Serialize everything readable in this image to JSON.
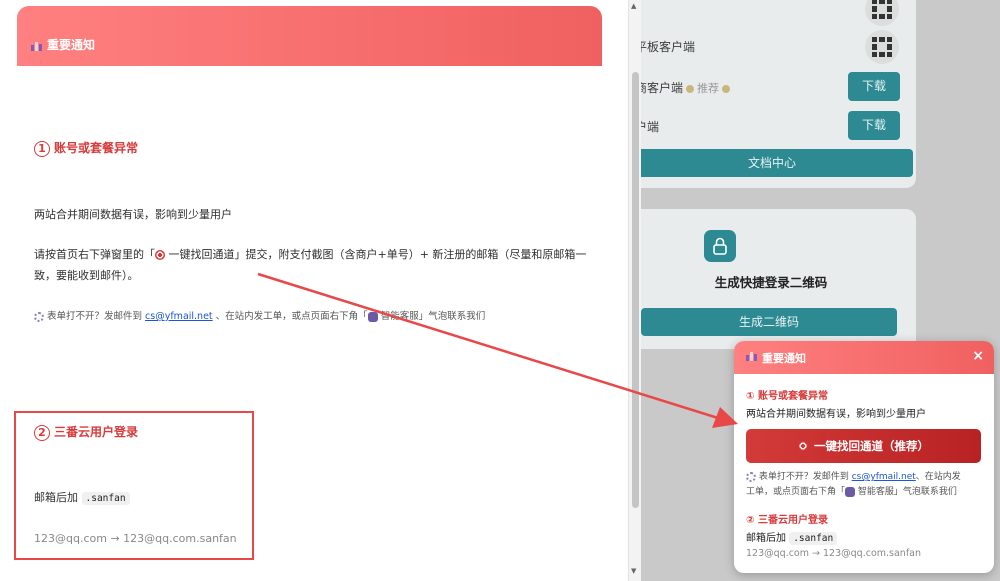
{
  "background_app": {
    "rows": [
      {
        "label": "平板客户端",
        "action": "qr"
      },
      {
        "label": "商客户端",
        "tag": "推荐",
        "action": "下载"
      },
      {
        "label": "户端",
        "action": "下载"
      }
    ],
    "doc_center_label": "文档中心",
    "quick_login": {
      "title": "生成快捷登录二维码",
      "button_label": "生成二维码"
    }
  },
  "notice": {
    "header_title": "重要通知",
    "section1": {
      "num": "1",
      "title": "账号或套餐异常",
      "line1": "两站合并期间数据有误，影响到少量用户",
      "para_a": "请按首页右下弹窗里的「",
      "para_b": " 一键找回通道」提交，附支付截图（含商户+单号）+ 新注册的邮箱（尽量和原邮箱一",
      "para_c": "致，要能收到邮件）。",
      "tip_a": " 表单打不开？发邮件到 ",
      "email": "cs@yfmail.net",
      "tip_b": " 、在站内发工单，或点页面右下角「",
      "tip_c": " 智能客服」气泡联系我们"
    },
    "section2": {
      "num": "2",
      "title": "三番云用户登录",
      "line_label": "邮箱后加 ",
      "suffix": ".sanfan",
      "example": "123@qq.com → 123@qq.com.sanfan"
    }
  },
  "popup": {
    "header_title": "重要通知",
    "close": "×",
    "section1_title": "账号或套餐异常",
    "section1_num": "①",
    "line1": "两站合并期间数据有误，影响到少量用户",
    "cta_label": "一键找回通道（推荐）",
    "tip_a": " 表单打不开？发邮件到 ",
    "email": "cs@yfmail.net",
    "tip_b": "、在站内发",
    "tip_c": "工单，或点页面右下角「",
    "tip_d": " 智能客服」气泡联系我们",
    "section2_num": "②",
    "section2_title": "三番云用户登录",
    "line_label": "邮箱后加 ",
    "suffix": ".sanfan",
    "example": "123@qq.com → 123@qq.com.sanfan"
  },
  "colors": {
    "header_gradient_start": "#ff8080",
    "header_gradient_end": "#f06060",
    "section_title": "#d83b3b",
    "cta_red": "#c62d2d",
    "link": "#1a56d6",
    "teal_button": "#2d8a93",
    "annotation_red": "#e84848"
  },
  "icons": {
    "header": "flag-icon",
    "target": "target-icon",
    "gear": "gear-icon",
    "bot": "bot-icon",
    "lock": "lock-icon",
    "qr": "qr-code-icon"
  }
}
